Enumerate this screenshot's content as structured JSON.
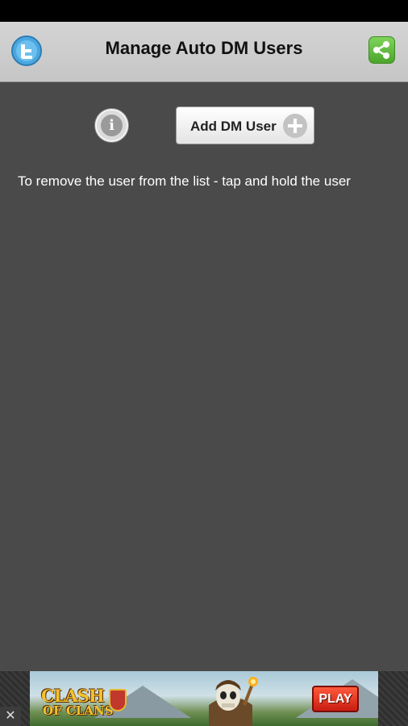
{
  "header": {
    "title": "Manage Auto DM Users",
    "left_icon": "twitter-bird-icon",
    "right_icon": "share-icon"
  },
  "toolbar": {
    "info_icon": "info-icon",
    "info_glyph": "i",
    "add_button_label": "Add DM User",
    "add_icon": "plus-circle-icon"
  },
  "hint": {
    "text": "To remove the user from the list - tap and hold the user"
  },
  "ad": {
    "logo_line1": "CLASH",
    "logo_line2": "OF CLANS",
    "cta_label": "PLAY",
    "close_glyph": "✕"
  },
  "colors": {
    "background": "#4a4a4a",
    "header": "#cccccc",
    "share_green": "#5cb83a",
    "play_red": "#d9261a"
  }
}
